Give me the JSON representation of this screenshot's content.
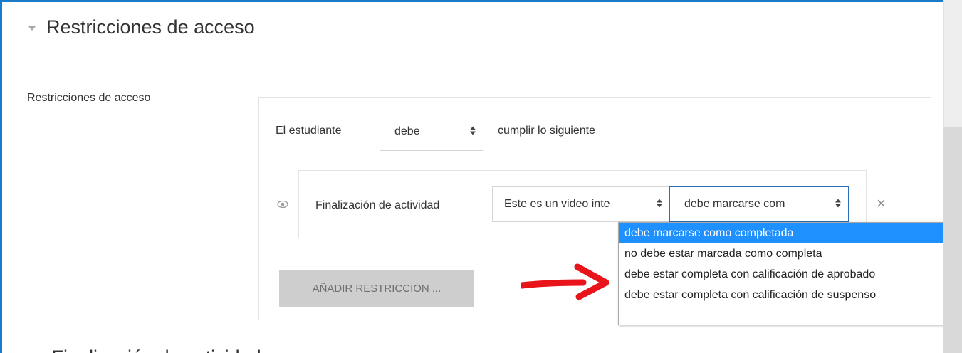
{
  "section": {
    "title": "Restricciones de acceso",
    "next_title": "Finalización de actividad"
  },
  "field_label": "Restricciones de acceso",
  "restriction_set": {
    "prefix": "El estudiante",
    "must_value": "debe",
    "suffix": "cumplir lo siguiente"
  },
  "condition": {
    "type_label": "Finalización de actividad",
    "activity_value": "Este es un video inte",
    "completion_value": "debe marcarse com"
  },
  "add_button_label": "AÑADIR RESTRICCIÓN ...",
  "dropdown": {
    "options": [
      "debe marcarse como completada",
      "no debe estar marcada como completa",
      "debe estar completa con calificación de aprobado",
      "debe estar completa con calificación de suspenso"
    ],
    "selected_index": 0
  },
  "colors": {
    "frame_border": "#1c7bc8",
    "selected_option": "#1e90ff",
    "arrow": "#e8141a"
  }
}
